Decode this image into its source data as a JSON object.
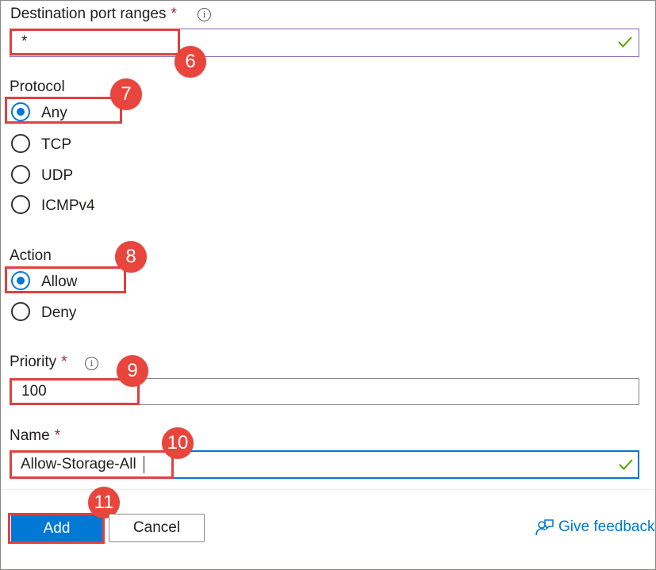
{
  "destination_port": {
    "label": "Destination port ranges",
    "required_mark": "*",
    "info_glyph": "i",
    "value": "*",
    "valid": true
  },
  "protocol": {
    "label": "Protocol",
    "options": [
      "Any",
      "TCP",
      "UDP",
      "ICMPv4"
    ],
    "selected": "Any"
  },
  "action": {
    "label": "Action",
    "options": [
      "Allow",
      "Deny"
    ],
    "selected": "Allow"
  },
  "priority": {
    "label": "Priority",
    "required_mark": "*",
    "info_glyph": "i",
    "value": "100"
  },
  "name": {
    "label": "Name",
    "required_mark": "*",
    "value": "Allow-Storage-All",
    "valid": true
  },
  "footer": {
    "add_label": "Add",
    "cancel_label": "Cancel",
    "feedback_label": "Give feedback"
  },
  "callouts": [
    "6",
    "7",
    "8",
    "9",
    "10",
    "11"
  ],
  "colors": {
    "accent": "#0078d4",
    "callout": "#e8453c",
    "success": "#57a300",
    "required": "#a4262c"
  }
}
